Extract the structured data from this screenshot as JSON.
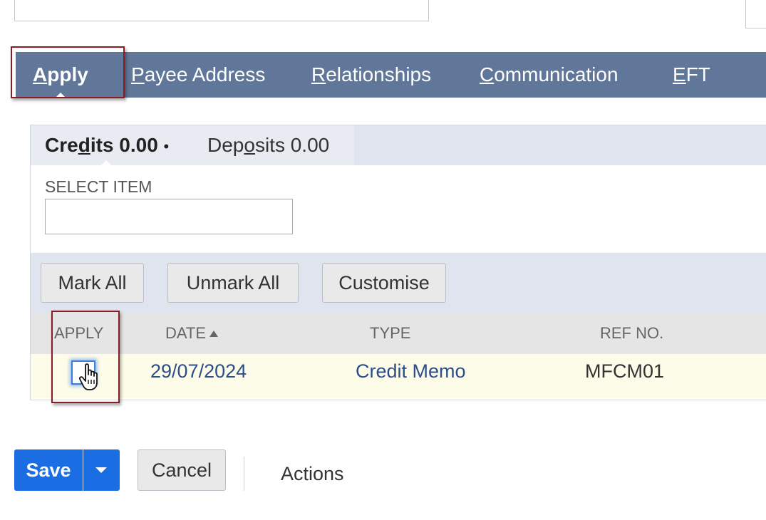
{
  "tabs": [
    {
      "pre": "",
      "key": "A",
      "post": "pply",
      "active": true
    },
    {
      "pre": "",
      "key": "P",
      "post": "ayee Address",
      "active": false
    },
    {
      "pre": "",
      "key": "R",
      "post": "elationships",
      "active": false
    },
    {
      "pre": "",
      "key": "C",
      "post": "ommunication",
      "active": false
    },
    {
      "pre": "",
      "key": "E",
      "post": "FT",
      "active": false
    }
  ],
  "subtabs": {
    "credits": {
      "pre": "Cre",
      "key": "d",
      "post": "its 0.00",
      "bullet": "•"
    },
    "deposits": {
      "pre": "Dep",
      "key": "o",
      "post": "sits 0.00"
    }
  },
  "select_item": {
    "label": "SELECT ITEM",
    "value": ""
  },
  "buttons": {
    "mark_all": "Mark All",
    "unmark_all": "Unmark All",
    "customise": "Customise"
  },
  "columns": {
    "apply": "APPLY",
    "date": "DATE",
    "type": "TYPE",
    "ref_no": "REF NO."
  },
  "rows": [
    {
      "apply": false,
      "date": "29/07/2024",
      "type": "Credit Memo",
      "ref_no": "MFCM01"
    }
  ],
  "footer": {
    "save": "Save",
    "cancel": "Cancel",
    "actions": "Actions"
  },
  "colors": {
    "tab_bar": "#607799",
    "save": "#1a6de3",
    "highlight": "#8a1c24",
    "row_bg": "#fcfce8"
  },
  "icons": {
    "sort": "sort-ascending-icon",
    "cursor": "hand-pointer-cursor-icon",
    "dropdown": "chevron-down-icon"
  }
}
